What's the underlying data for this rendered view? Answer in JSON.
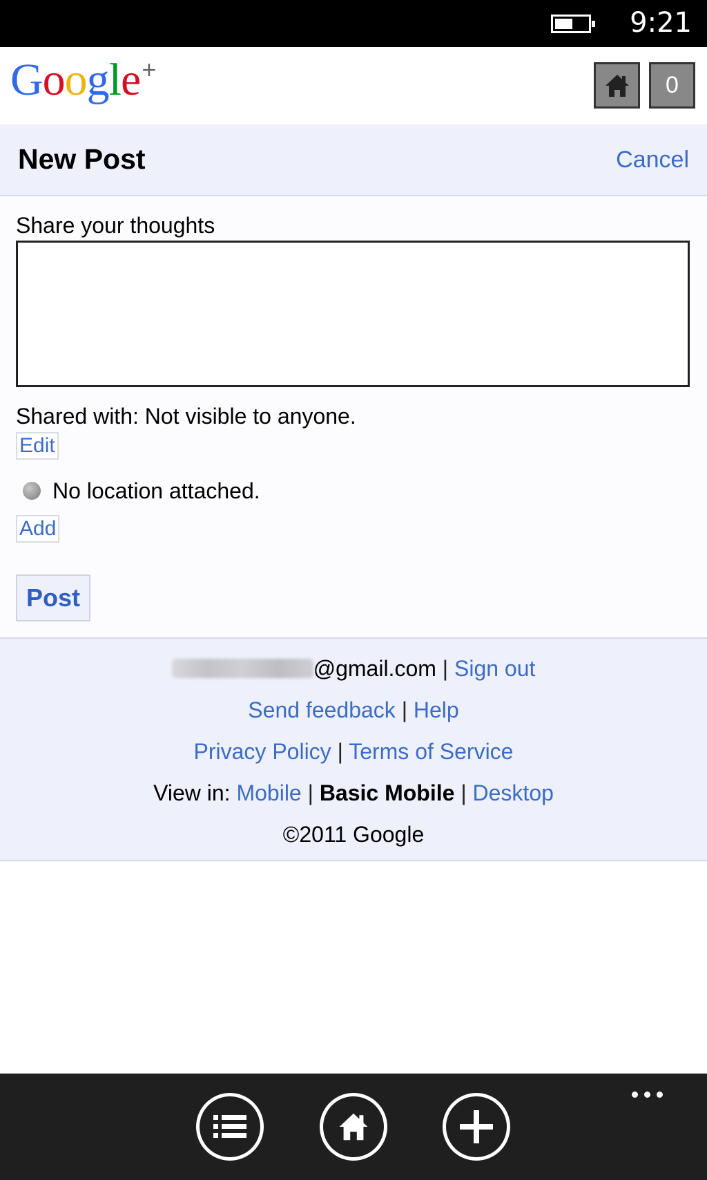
{
  "status_bar": {
    "time": "9:21",
    "battery_icon": "battery-icon"
  },
  "header": {
    "logo": {
      "letters": [
        "G",
        "o",
        "o",
        "g",
        "l",
        "e"
      ],
      "plus": "+",
      "colors": [
        "#3369e8",
        "#d50f25",
        "#eeb211",
        "#3369e8",
        "#009925",
        "#d50f25"
      ]
    },
    "home_icon": "home-icon",
    "notification_count": "0"
  },
  "title_bar": {
    "title": "New Post",
    "cancel": "Cancel"
  },
  "form": {
    "share_label": "Share your thoughts",
    "thoughts_value": "",
    "shared_with": "Shared with: Not visible to anyone.",
    "edit": "Edit",
    "location_text": "No location attached.",
    "add": "Add",
    "post": "Post"
  },
  "footer": {
    "email_suffix": "@gmail.com",
    "sign_out": "Sign out",
    "send_feedback": "Send feedback",
    "help": "Help",
    "privacy_policy": "Privacy Policy",
    "terms": "Terms of Service",
    "view_in": "View in:",
    "mobile": "Mobile",
    "basic_mobile": "Basic Mobile",
    "desktop": "Desktop",
    "copyright": "©2011 Google",
    "separator": "|"
  },
  "app_bar": {
    "buttons": [
      "list-icon",
      "home-icon",
      "add-icon"
    ],
    "more_icon": "more-icon"
  },
  "colors": {
    "link": "#3b6cc6",
    "panel": "#eef0fb",
    "app_bar": "#1f1f1f"
  }
}
